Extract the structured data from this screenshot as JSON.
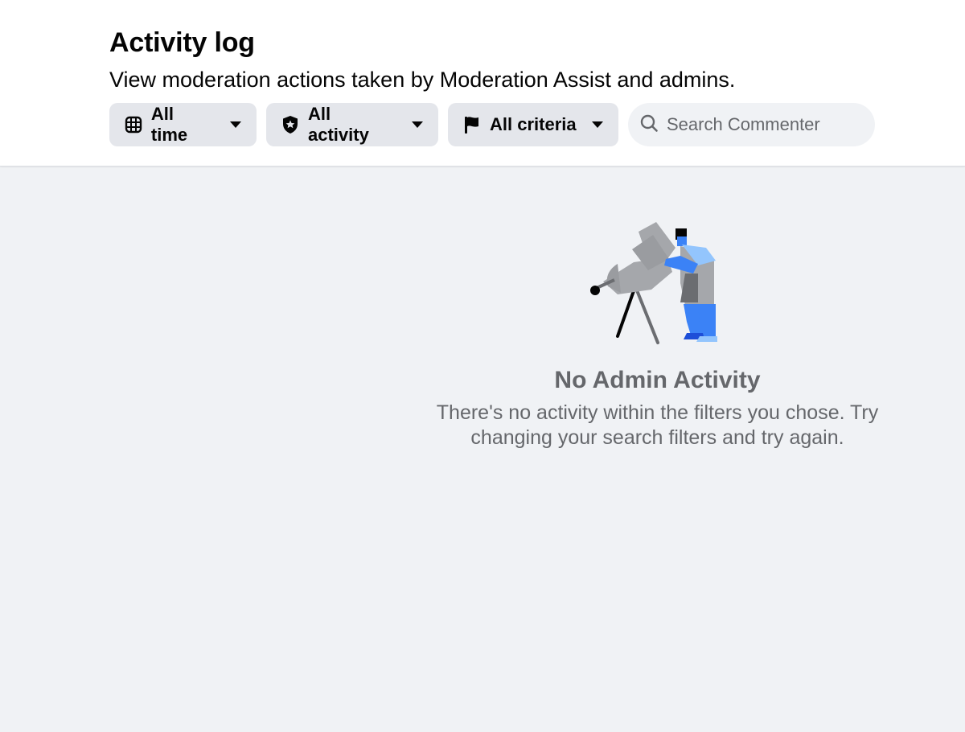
{
  "header": {
    "title": "Activity log",
    "subtitle": "View moderation actions taken by Moderation Assist and admins."
  },
  "filters": [
    {
      "label": "All time",
      "icon": "calendar-icon"
    },
    {
      "label": "All activity",
      "icon": "shield-star-icon"
    },
    {
      "label": "All criteria",
      "icon": "flag-icon"
    }
  ],
  "search": {
    "placeholder": "Search Commenter",
    "value": "",
    "icon": "search-icon"
  },
  "empty_state": {
    "title": "No Admin Activity",
    "description": "There's no activity within the filters you chose. Try changing your search filters and try again.",
    "illustration": "person-with-telescope-illustration"
  },
  "colors": {
    "header_bg": "#ffffff",
    "page_bg": "#f0f2f5",
    "chip_bg": "#e4e6eb",
    "primary_text": "#050505",
    "secondary_text": "#65676b",
    "accent_blue": "#3b82f6",
    "light_blue": "#93c5fd"
  }
}
